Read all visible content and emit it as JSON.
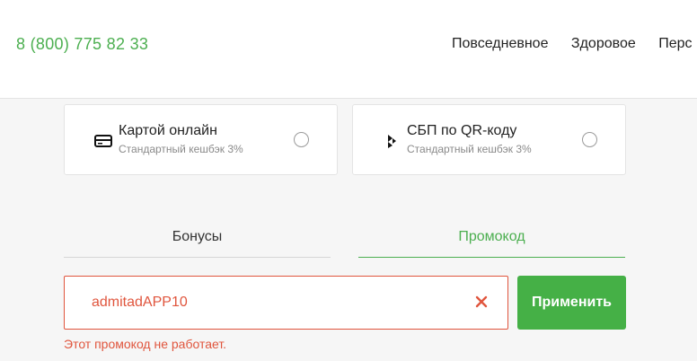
{
  "header": {
    "phone": "8 (800) 775 82 33",
    "nav": [
      "Повседневное",
      "Здоровое",
      "Перс"
    ]
  },
  "payment": {
    "options": [
      {
        "title": "Картой онлайн",
        "subtitle": "Стандартный кешбэк 3%",
        "icon": "credit-card-icon",
        "selected": false
      },
      {
        "title": "СБП по QR-коду",
        "subtitle": "Стандартный кешбэк 3%",
        "icon": "sbp-icon",
        "selected": false
      }
    ]
  },
  "tabs": {
    "bonus": "Бонусы",
    "promo": "Промокод",
    "active": "promo"
  },
  "promo": {
    "value": "admitadAPP10",
    "apply_label": "Применить",
    "error": "Этот промокод не работает."
  },
  "colors": {
    "accent": "#4caf50",
    "button": "#45b046",
    "error": "#e0553d"
  }
}
